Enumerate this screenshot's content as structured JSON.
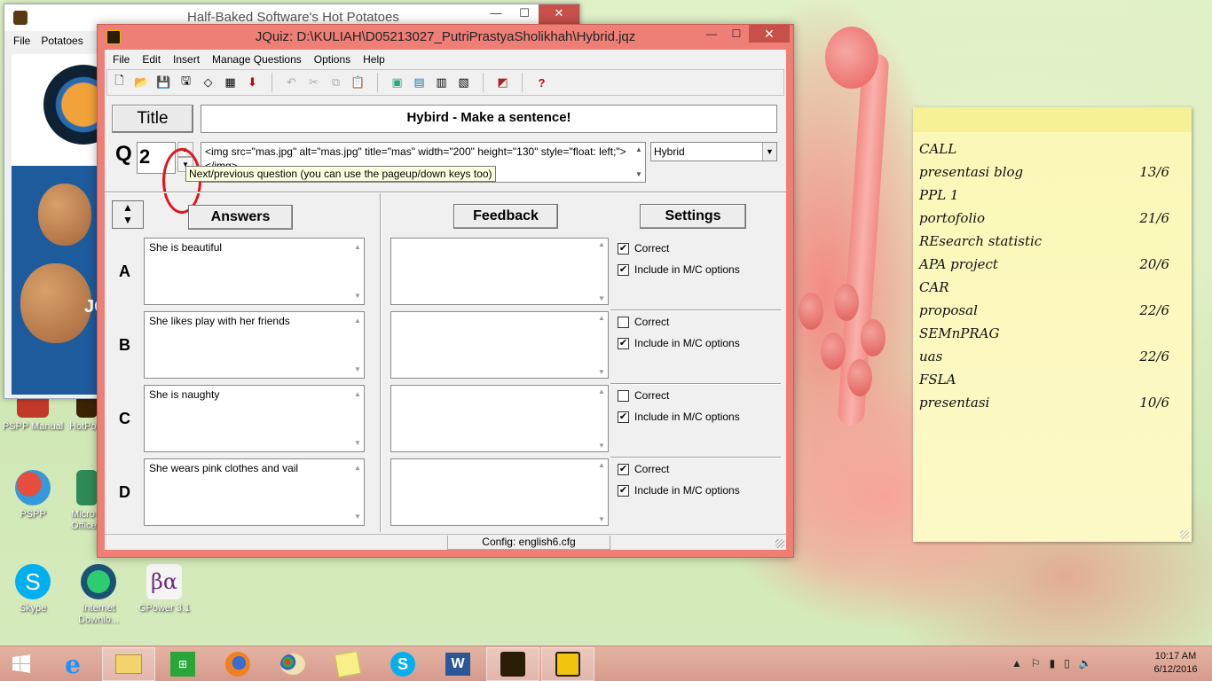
{
  "hp_window": {
    "title": "Half-Baked Software's Hot Potatoes",
    "menu": [
      "File",
      "Potatoes"
    ],
    "logo_text": "JQ"
  },
  "desktop_icons": [
    {
      "label": "PSPP Manual"
    },
    {
      "label": "HotPo"
    },
    {
      "label": "PSPP"
    },
    {
      "label": "Micro Office"
    },
    {
      "label": "Skype"
    },
    {
      "label": "Internet Downlo..."
    },
    {
      "label": "GPower 3.1"
    }
  ],
  "jquiz": {
    "title": "JQuiz: D:\\KULIAH\\D05213027_PutriPrastyaSholikhah\\Hybrid.jqz",
    "menu": [
      "File",
      "Edit",
      "Insert",
      "Manage Questions",
      "Options",
      "Help"
    ],
    "title_button": "Title",
    "quiz_title": "Hybird - Make a sentence!",
    "q_label": "Q",
    "question_number": "2",
    "question_text": "<img src=\"mas.jpg\" alt=\"mas.jpg\" title=\"mas\" width=\"200\" height=\"130\" style=\"float: left;\"></img>",
    "question_type": "Hybrid",
    "tooltip": "Next/previous question (you can use the pageup/down keys too)",
    "answers_header": "Answers",
    "feedback_header": "Feedback",
    "settings_header": "Settings",
    "correct_label": "Correct",
    "include_label": "Include in M/C options",
    "answers": [
      {
        "letter": "A",
        "text": "She is beautiful",
        "feedback": "",
        "correct": "✔",
        "include": "✔"
      },
      {
        "letter": "B",
        "text": "She likes play with her friends",
        "feedback": "",
        "correct": "",
        "include": "✔"
      },
      {
        "letter": "C",
        "text": "She is naughty",
        "feedback": "",
        "correct": "",
        "include": "✔"
      },
      {
        "letter": "D",
        "text": "She wears pink clothes and vail",
        "feedback": "",
        "correct": "✔",
        "include": "✔"
      }
    ],
    "status": "Config: english6.cfg"
  },
  "sticky_note": {
    "items": [
      {
        "task": "CALL",
        "date": ""
      },
      {
        "task": "presentasi blog",
        "date": "13/6"
      },
      {
        "task": "PPL 1",
        "date": ""
      },
      {
        "task": "portofolio",
        "date": "21/6"
      },
      {
        "task": "REsearch statistic",
        "date": ""
      },
      {
        "task": "APA project",
        "date": "20/6"
      },
      {
        "task": "CAR",
        "date": ""
      },
      {
        "task": "proposal",
        "date": "22/6"
      },
      {
        "task": "SEMnPRAG",
        "date": ""
      },
      {
        "task": "uas",
        "date": "22/6"
      },
      {
        "task": "FSLA",
        "date": ""
      },
      {
        "task": "presentasi",
        "date": "10/6"
      }
    ]
  },
  "taskbar": {
    "time": "10:17 AM",
    "date": "6/12/2016"
  },
  "colors": {
    "jquiz_frame": "#ef7f76",
    "sticky": "#fcf9c7",
    "taskbar": "#dca090"
  }
}
